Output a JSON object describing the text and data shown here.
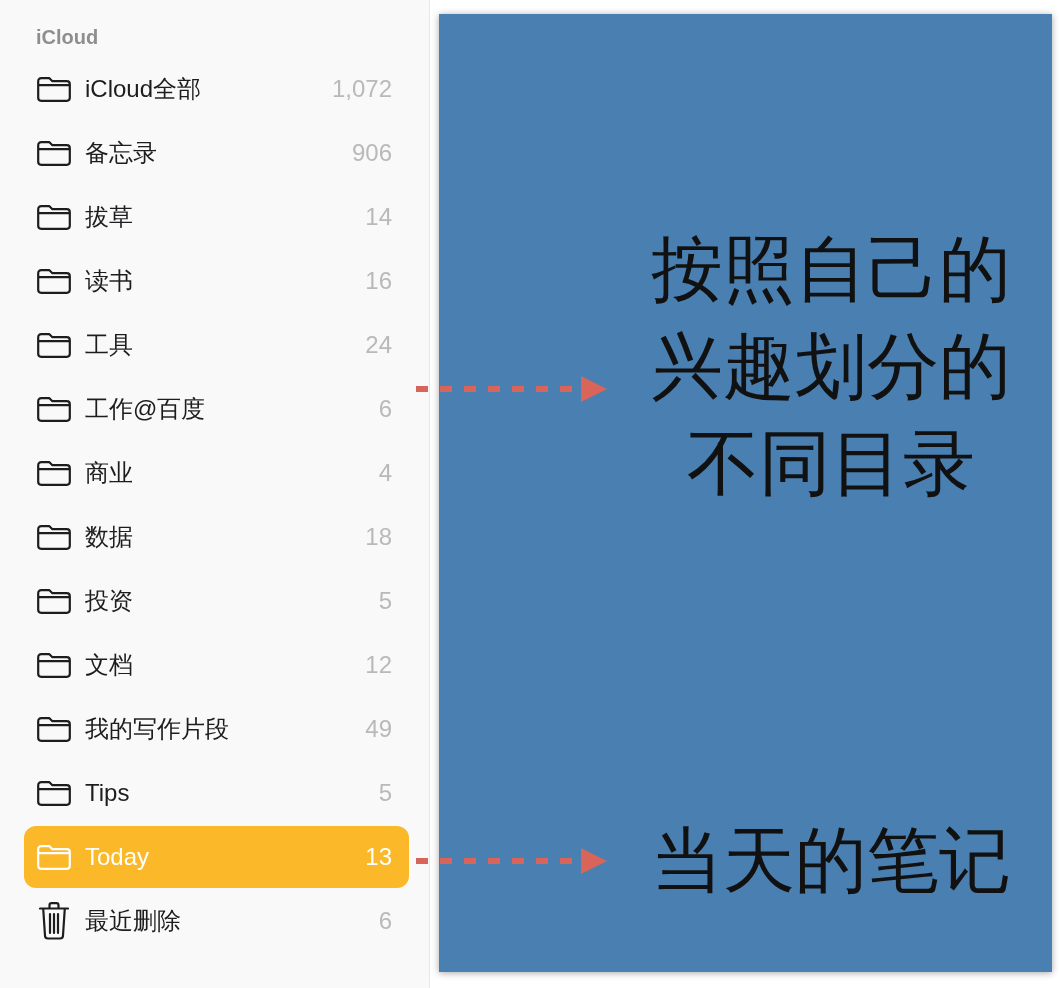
{
  "sidebar": {
    "section_title": "iCloud",
    "items": [
      {
        "kind": "folder",
        "label": "iCloud全部",
        "count": "1,072",
        "selected": false
      },
      {
        "kind": "folder",
        "label": "备忘录",
        "count": "906",
        "selected": false
      },
      {
        "kind": "folder",
        "label": "拔草",
        "count": "14",
        "selected": false
      },
      {
        "kind": "folder",
        "label": "读书",
        "count": "16",
        "selected": false
      },
      {
        "kind": "folder",
        "label": "工具",
        "count": "24",
        "selected": false
      },
      {
        "kind": "folder",
        "label": "工作@百度",
        "count": "6",
        "selected": false
      },
      {
        "kind": "folder",
        "label": "商业",
        "count": "4",
        "selected": false
      },
      {
        "kind": "folder",
        "label": "数据",
        "count": "18",
        "selected": false
      },
      {
        "kind": "folder",
        "label": "投资",
        "count": "5",
        "selected": false
      },
      {
        "kind": "folder",
        "label": "文档",
        "count": "12",
        "selected": false
      },
      {
        "kind": "folder",
        "label": "我的写作片段",
        "count": "49",
        "selected": false
      },
      {
        "kind": "folder",
        "label": "Tips",
        "count": "5",
        "selected": false
      },
      {
        "kind": "folder",
        "label": "Today",
        "count": "13",
        "selected": true
      },
      {
        "kind": "trash",
        "label": "最近删除",
        "count": "6",
        "selected": false
      }
    ]
  },
  "annotations": [
    {
      "text": "按照自己的兴趣划分的不同目录"
    },
    {
      "text": "当天的笔记"
    }
  ]
}
